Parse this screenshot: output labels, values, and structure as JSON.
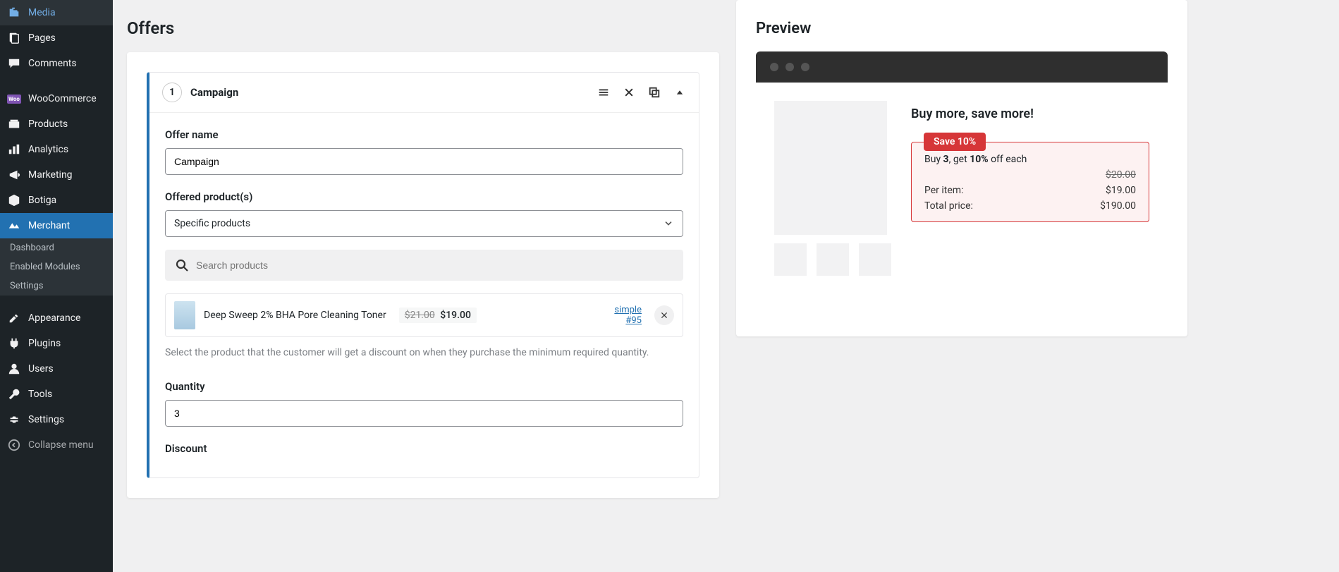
{
  "sidebar": {
    "media": "Media",
    "pages": "Pages",
    "comments": "Comments",
    "woocommerce": "WooCommerce",
    "products": "Products",
    "analytics": "Analytics",
    "marketing": "Marketing",
    "botiga": "Botiga",
    "merchant": "Merchant",
    "dashboard": "Dashboard",
    "enabled_modules": "Enabled Modules",
    "settings_sub": "Settings",
    "appearance": "Appearance",
    "plugins": "Plugins",
    "users": "Users",
    "tools": "Tools",
    "settings": "Settings",
    "collapse": "Collapse menu"
  },
  "offers": {
    "title": "Offers",
    "step": "1",
    "campaign_label": "Campaign",
    "offer_name_label": "Offer name",
    "offer_name_value": "Campaign",
    "offered_products_label": "Offered product(s)",
    "products_select": "Specific products",
    "search_placeholder": "Search products",
    "product_name": "Deep Sweep 2% BHA Pore Cleaning Toner",
    "price_old": "$21.00",
    "price_new": "$19.00",
    "product_type": "simple",
    "product_id": "#95",
    "help": "Select the product that the customer will get a discount on when they purchase the minimum required quantity.",
    "quantity_label": "Quantity",
    "quantity_value": "3",
    "discount_label": "Discount"
  },
  "preview": {
    "title": "Preview",
    "promo_title": "Buy more, save more!",
    "save_badge": "Save 10%",
    "buy_prefix": "Buy ",
    "buy_qty": "3",
    "buy_mid": ", get ",
    "buy_pct": "10%",
    "buy_suffix": " off each",
    "per_item_label": "Per item:",
    "per_item_old": "$20.00",
    "per_item_new": "$19.00",
    "total_label": "Total price:",
    "total_value": "$190.00"
  }
}
